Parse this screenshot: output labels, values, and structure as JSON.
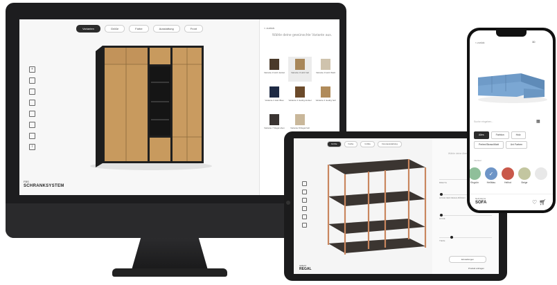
{
  "desktop": {
    "tabs": [
      "Varianten",
      "Größe",
      "Farbe",
      "Ausstattung",
      "Front"
    ],
    "active_tab": 0,
    "back_label": "< zurück",
    "panel_title": "Wähle deine gewünschte Variante aus.",
    "variants": [
      {
        "label": "Variante 3 Holz dunkel",
        "color": "#4a3a2a",
        "selected": false
      },
      {
        "label": "Variante 3 Holz hell",
        "color": "#a8875a",
        "selected": true
      },
      {
        "label": "Variante 3 Holz Weiß",
        "color": "#cfc3ad",
        "selected": false
      },
      {
        "label": "Variante 3 Holz Blau",
        "color": "#1e2a44",
        "selected": false
      },
      {
        "label": "Variante 4 niedrig dunkel",
        "color": "#6b4a2a",
        "selected": false
      },
      {
        "label": "Variante 4 niedrig hell",
        "color": "#b08b5a",
        "selected": false
      },
      {
        "label": "Variante 7 Regal oben",
        "color": "#3a3432",
        "selected": false
      },
      {
        "label": "Variante 8 Regal hell",
        "color": "#c9b79a",
        "selected": false
      }
    ],
    "brand_small": "FBS",
    "brand": "SCHRANKSYSTEM",
    "tool_icons": [
      "zoom-icon",
      "trash-icon",
      "copy-icon",
      "move-icon",
      "edit-icon",
      "grid-icon",
      "eye-icon",
      "info-icon"
    ]
  },
  "tablet": {
    "tabs": [
      "Größe",
      "Farbe",
      "Größe",
      "Innenausstattung"
    ],
    "active_tab": 0,
    "panel_title": "Wähle deine Abmessungen aus.",
    "sliders": [
      {
        "label": "BREITE",
        "value": 0.75
      },
      {
        "label": "HÖHE DER REGALBÖDEN",
        "value": 0.02
      },
      {
        "label": "HÖHE",
        "value": 0.02
      },
      {
        "label": "TIEFE",
        "value": 0.22
      }
    ],
    "button_label": "Einstellungen",
    "brand_small": "GREAT",
    "brand": "REGAL",
    "cart_label": "Produkt anfragen"
  },
  "phone": {
    "back_label": "< zurück",
    "view_label": "3D",
    "search_placeholder": "Suche eingeben...",
    "chips": [
      {
        "label": "Alles",
        "active": true
      },
      {
        "label": "Farbton",
        "active": false
      },
      {
        "label": "Holz",
        "active": false
      },
      {
        "label": "Perlen/Strass/Matt",
        "active": false
      },
      {
        "label": "Uni Farben",
        "active": false
      }
    ],
    "section_label": "Interieur",
    "colors": [
      {
        "name": "Eisgrün",
        "hex": "#8fbf9a"
      },
      {
        "name": "Hellblau",
        "hex": "#6e95c7"
      },
      {
        "name": "Hellrot",
        "hex": "#c9584a"
      },
      {
        "name": "Beige",
        "hex": "#c3c6a0"
      },
      {
        "name": "",
        "hex": "#e8e8e8"
      }
    ],
    "brand_small": "Heimatome",
    "brand": "SOFA",
    "icons": [
      "heart-icon",
      "cart-icon"
    ]
  }
}
